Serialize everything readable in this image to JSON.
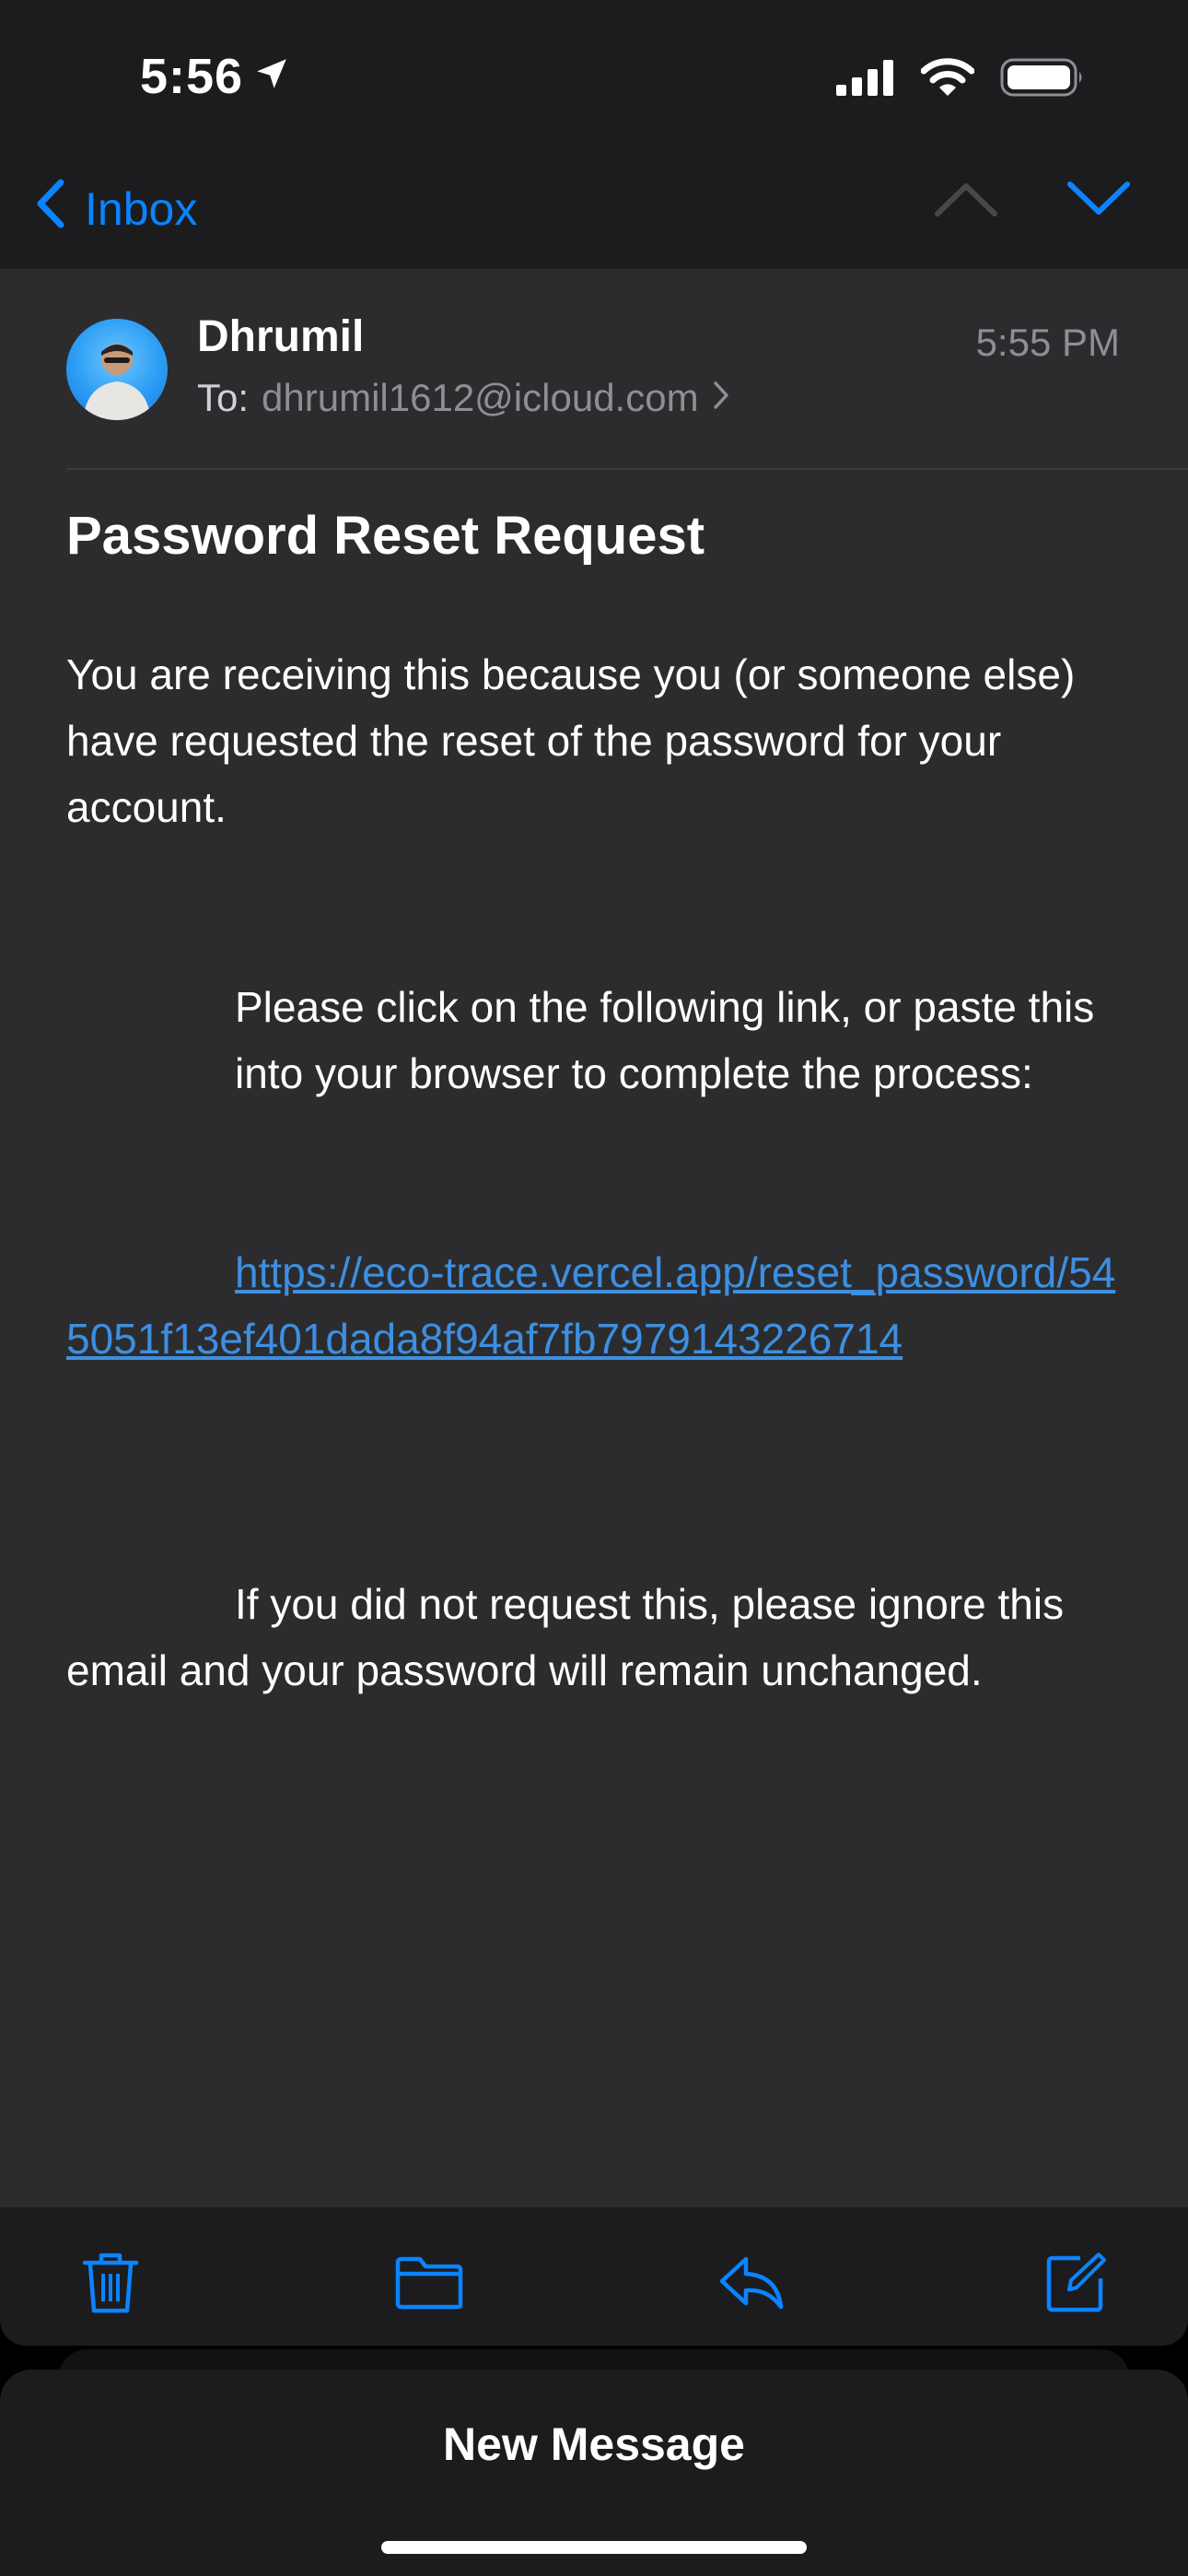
{
  "status_bar": {
    "time": "5:56",
    "icons": [
      "location-arrow-icon",
      "cellular-signal-icon",
      "wifi-icon",
      "battery-icon"
    ]
  },
  "nav": {
    "back_label": "Inbox",
    "icons": [
      "chevron-left-icon",
      "chevron-up-icon",
      "chevron-down-icon"
    ]
  },
  "message": {
    "sender": "Dhrumil",
    "to_label": "To:",
    "recipient": "dhrumil1612@icloud.com",
    "time": "5:55 PM",
    "subject": "Password Reset Request",
    "paragraph_1": "You are receiving this because you (or someone else) have requested the reset of the password for your account.",
    "paragraph_2": "Please click on the following link, or paste this into your browser to complete the process:",
    "link": "https://eco-trace.vercel.app/reset_password/545051f13ef401dada8f94af7fb7979143226714",
    "paragraph_3": "If you did not request this, please ignore this email and your password will remain unchanged."
  },
  "toolbar": {
    "icons": [
      "trash-icon",
      "folder-icon",
      "reply-icon",
      "compose-icon"
    ]
  },
  "draft_sheet": {
    "title": "New Message"
  },
  "colors": {
    "accent": "#0a84ff",
    "link": "#3d8fe0",
    "card_background": "#2c2c2e",
    "chrome_background": "#1c1c1e",
    "secondary_text": "#8e8e93"
  }
}
